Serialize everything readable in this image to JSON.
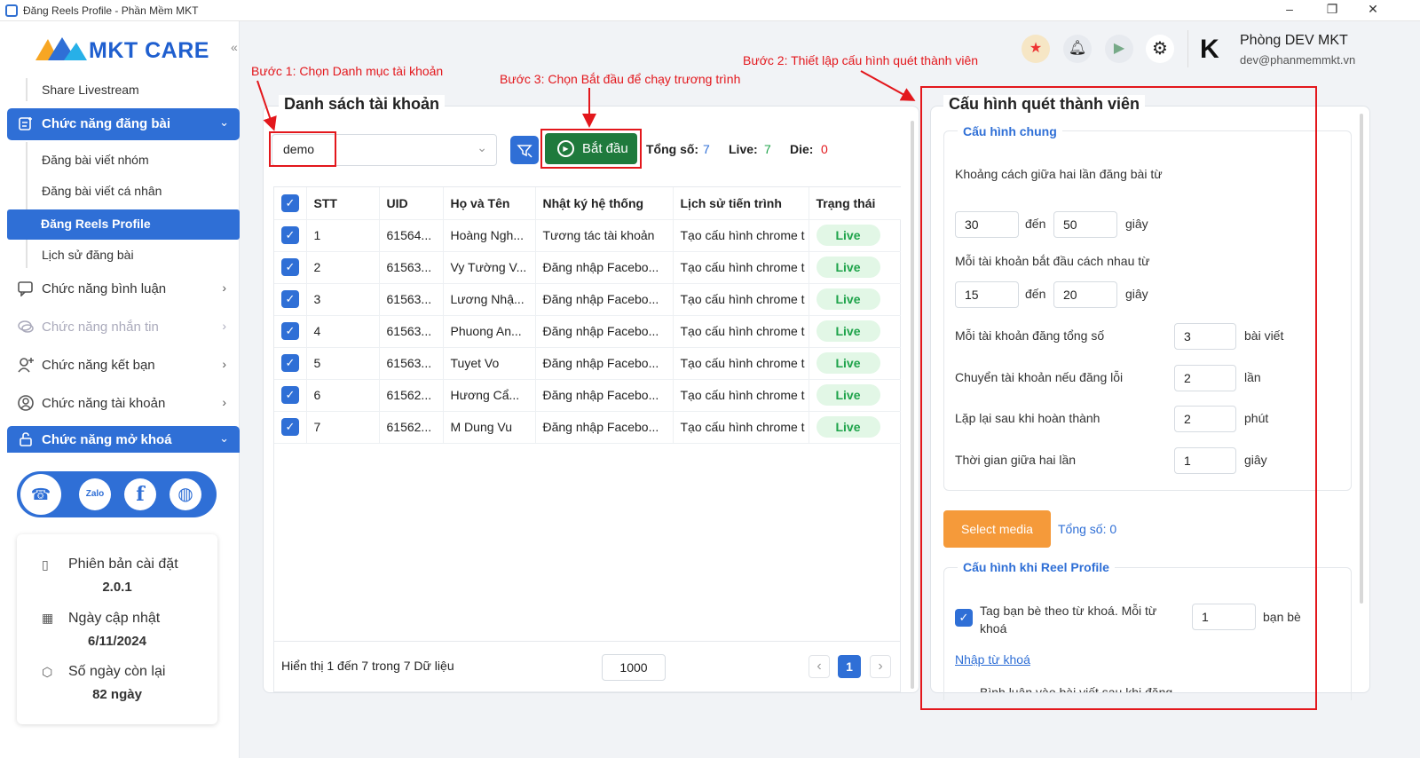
{
  "window": {
    "title": "Đăng Reels Profile - Phần Mềm MKT",
    "min": "–",
    "max": "❐",
    "close": "✕"
  },
  "sidebar": {
    "logo": "MKT CARE",
    "collapse_icon": "«",
    "share_livestream": "Share Livestream",
    "group_post": "Chức năng đăng bài",
    "sub_items": [
      "Đăng bài viết nhóm",
      "Đăng bài viết cá nhân",
      "Đăng Reels Profile",
      "Lịch sử đăng bài"
    ],
    "menus": [
      "Chức năng bình luận",
      "Chức năng nhắn tin",
      "Chức năng kết bạn",
      "Chức năng tài khoản"
    ],
    "group_unlock": "Chức năng mở khoá",
    "social": [
      "support-icon",
      "zalo-icon",
      "facebook-icon",
      "globe-icon"
    ],
    "zalo": "Zalo",
    "info": {
      "version_label": "Phiên bản cài đặt",
      "version": "2.0.1",
      "updated_label": "Ngày cập nhật",
      "updated": "6/11/2024",
      "remaining_label": "Số ngày còn lại",
      "remaining": "82 ngày"
    }
  },
  "header": {
    "user_name": "Phòng DEV MKT",
    "user_email": "dev@phanmemmkt.vn",
    "avatar": "K"
  },
  "annotations": {
    "step1": "Bước 1: Chọn Danh mục tài khoản",
    "step2": "Bước 2: Thiết lập cấu hình quét thành viên",
    "step3": "Bước 3: Chọn Bắt đầu để chạy trương trình"
  },
  "accounts": {
    "title": "Danh sách tài khoản",
    "category": "demo",
    "start": "Bắt đầu",
    "total_label": "Tổng số:",
    "total": "7",
    "live_label": "Live:",
    "live": "7",
    "die_label": "Die:",
    "die": "0",
    "columns": [
      "STT",
      "UID",
      "Họ và Tên",
      "Nhật ký hệ thống",
      "Lịch sử tiến trình",
      "Trạng thái"
    ],
    "rows": [
      [
        "1",
        "61564...",
        "Hoàng Ngh...",
        "Tương tác tài khoản",
        "Tạo cấu hình chrome t",
        "Live"
      ],
      [
        "2",
        "61563...",
        "Vy Tường V...",
        "Đăng nhập Facebo...",
        "Tạo cấu hình chrome t",
        "Live"
      ],
      [
        "3",
        "61563...",
        "Lương Nhậ...",
        "Đăng nhập Facebo...",
        "Tạo cấu hình chrome t",
        "Live"
      ],
      [
        "4",
        "61563...",
        "Phuong An...",
        "Đăng nhập Facebo...",
        "Tạo cấu hình chrome t",
        "Live"
      ],
      [
        "5",
        "61563...",
        "Tuyet Vo",
        "Đăng nhập Facebo...",
        "Tạo cấu hình chrome t",
        "Live"
      ],
      [
        "6",
        "61562...",
        "Hương Cẩ...",
        "Đăng nhập Facebo...",
        "Tạo cấu hình chrome t",
        "Live"
      ],
      [
        "7",
        "61562...",
        "M Dung Vu",
        "Đăng nhập Facebo...",
        "Tạo cấu hình chrome t",
        "Live"
      ]
    ],
    "footer": "Hiển thị 1 đến 7 trong 7 Dữ liệu",
    "page_size": "1000",
    "page": "1",
    "prev": "‹",
    "next": "›"
  },
  "config": {
    "title": "Cấu hình quét thành viên",
    "general": "Cấu hình chung",
    "gap_label": "Khoảng cách giữa hai lần đăng bài từ",
    "gap_from": "30",
    "gap_to": "50",
    "to": "đến",
    "sec": "giây",
    "acc_gap_label": "Mỗi tài khoản bắt đầu cách nhau từ",
    "acc_from": "15",
    "acc_to": "20",
    "posts_label": "Mỗi tài khoản đăng tổng số",
    "posts": "3",
    "posts_unit": "bài viết",
    "switch_label": "Chuyển tài khoản nếu đăng lỗi",
    "switch": "2",
    "switch_unit": "lần",
    "repeat_label": "Lặp lại sau khi hoàn thành",
    "repeat": "2",
    "repeat_unit": "phút",
    "between_label": "Thời gian giữa hai lần",
    "between": "1",
    "between_unit": "giây",
    "select_media": "Select media",
    "media_total": "Tổng số: 0",
    "reel_title": "Cấu hình khi Reel Profile",
    "tag_label": "Tag bạn bè theo từ khoá. Mỗi từ khoá",
    "tag_value": "1",
    "tag_unit": "bạn bè",
    "keyword_link": "Nhập từ khoá",
    "comment_label": "Bình luận vào bài viết sau khi đăng"
  },
  "colors": {
    "accent": "#2f6fd6",
    "start": "#1f7a3d",
    "annotation": "#e3171c",
    "media": "#f59a3a"
  }
}
